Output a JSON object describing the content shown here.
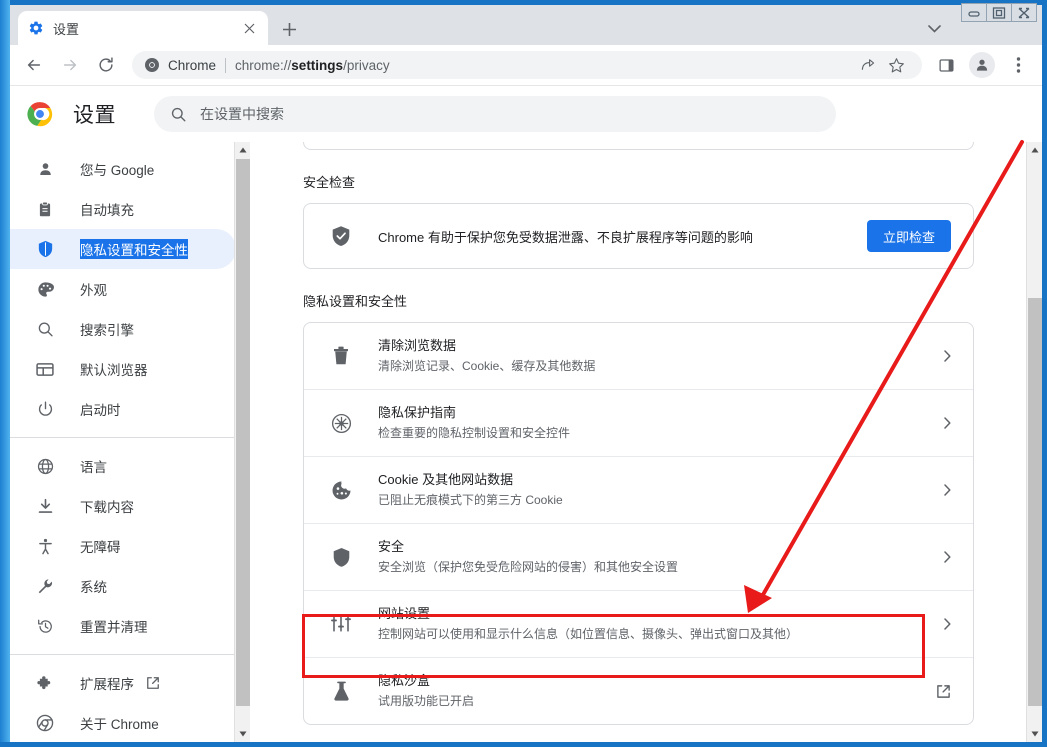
{
  "window": {
    "controls": [
      {
        "name": "minimize",
        "glyph": "minimize-icon"
      },
      {
        "name": "maximize",
        "glyph": "maximize-icon"
      },
      {
        "name": "close",
        "glyph": "close-icon"
      }
    ]
  },
  "tabstrip": {
    "tabs": [
      {
        "title": "设置",
        "favicon": "gear-icon",
        "active": true
      }
    ],
    "new_tab_label": "+",
    "tab_search_label": "tab-search"
  },
  "toolbar": {
    "back": "back-icon",
    "forward": "forward-icon",
    "reload": "reload-icon",
    "omnibox": {
      "brand": "Chrome",
      "url_prefix": "chrome://",
      "url_bold": "settings",
      "url_suffix": "/privacy",
      "full_url": "chrome://settings/privacy"
    },
    "share": "share-icon",
    "bookmark": "star-icon",
    "side_panel": "side-panel-icon",
    "profile": "avatar-icon",
    "menu": "three-dot-menu-icon"
  },
  "settings": {
    "title": "设置",
    "search": {
      "placeholder": "在设置中搜索",
      "value": ""
    }
  },
  "sidebar": {
    "items": [
      {
        "label": "您与 Google",
        "icon": "person-icon",
        "active": false
      },
      {
        "label": "自动填充",
        "icon": "clipboard-icon",
        "active": false
      },
      {
        "label": "隐私设置和安全性",
        "icon": "shield-icon",
        "active": true
      },
      {
        "label": "外观",
        "icon": "palette-icon",
        "active": false
      },
      {
        "label": "搜索引擎",
        "icon": "search-icon",
        "active": false
      },
      {
        "label": "默认浏览器",
        "icon": "browser-window-icon",
        "active": false
      },
      {
        "label": "启动时",
        "icon": "power-icon",
        "active": false
      }
    ],
    "items2": [
      {
        "label": "语言",
        "icon": "globe-icon",
        "active": false
      },
      {
        "label": "下载内容",
        "icon": "download-icon",
        "active": false
      },
      {
        "label": "无障碍",
        "icon": "accessibility-icon",
        "active": false
      },
      {
        "label": "系统",
        "icon": "wrench-icon",
        "active": false
      },
      {
        "label": "重置并清理",
        "icon": "history-restore-icon",
        "active": false
      }
    ],
    "items3": [
      {
        "label": "扩展程序",
        "icon": "puzzle-icon",
        "external": true
      },
      {
        "label": "关于 Chrome",
        "icon": "chrome-icon",
        "external": false
      }
    ]
  },
  "main": {
    "security_check": {
      "heading": "安全检查",
      "icon": "shield-check-icon",
      "description": "Chrome 有助于保护您免受数据泄露、不良扩展程序等问题的影响",
      "button_label": "立即检查"
    },
    "privacy_section": {
      "heading": "隐私设置和安全性",
      "rows": [
        {
          "icon": "trash-icon",
          "title": "清除浏览数据",
          "subtitle": "清除浏览记录、Cookie、缓存及其他数据",
          "action": "chevron-right-icon",
          "highlighted": false
        },
        {
          "icon": "privacy-guide-icon",
          "title": "隐私保护指南",
          "subtitle": "检查重要的隐私控制设置和安全控件",
          "action": "chevron-right-icon",
          "highlighted": false
        },
        {
          "icon": "cookie-icon",
          "title": "Cookie 及其他网站数据",
          "subtitle": "已阻止无痕模式下的第三方 Cookie",
          "action": "chevron-right-icon",
          "highlighted": false
        },
        {
          "icon": "shield-icon",
          "title": "安全",
          "subtitle": "安全浏览（保护您免受危险网站的侵害）和其他安全设置",
          "action": "chevron-right-icon",
          "highlighted": false
        },
        {
          "icon": "sliders-icon",
          "title": "网站设置",
          "subtitle": "控制网站可以使用和显示什么信息（如位置信息、摄像头、弹出式窗口及其他）",
          "action": "chevron-right-icon",
          "highlighted": true
        },
        {
          "icon": "flask-icon",
          "title": "隐私沙盒",
          "subtitle": "试用版功能已开启",
          "action": "open-external-icon",
          "highlighted": false
        }
      ]
    }
  },
  "annotation": {
    "box_target": "网站设置",
    "color": "#e81a1a"
  },
  "colors": {
    "accent": "#1a73e8",
    "selected_bg": "#e8f0fe",
    "annotation_red": "#e81a1a",
    "text_primary": "#202124",
    "text_secondary": "#5f6368",
    "window_frame": "#1773c4"
  }
}
